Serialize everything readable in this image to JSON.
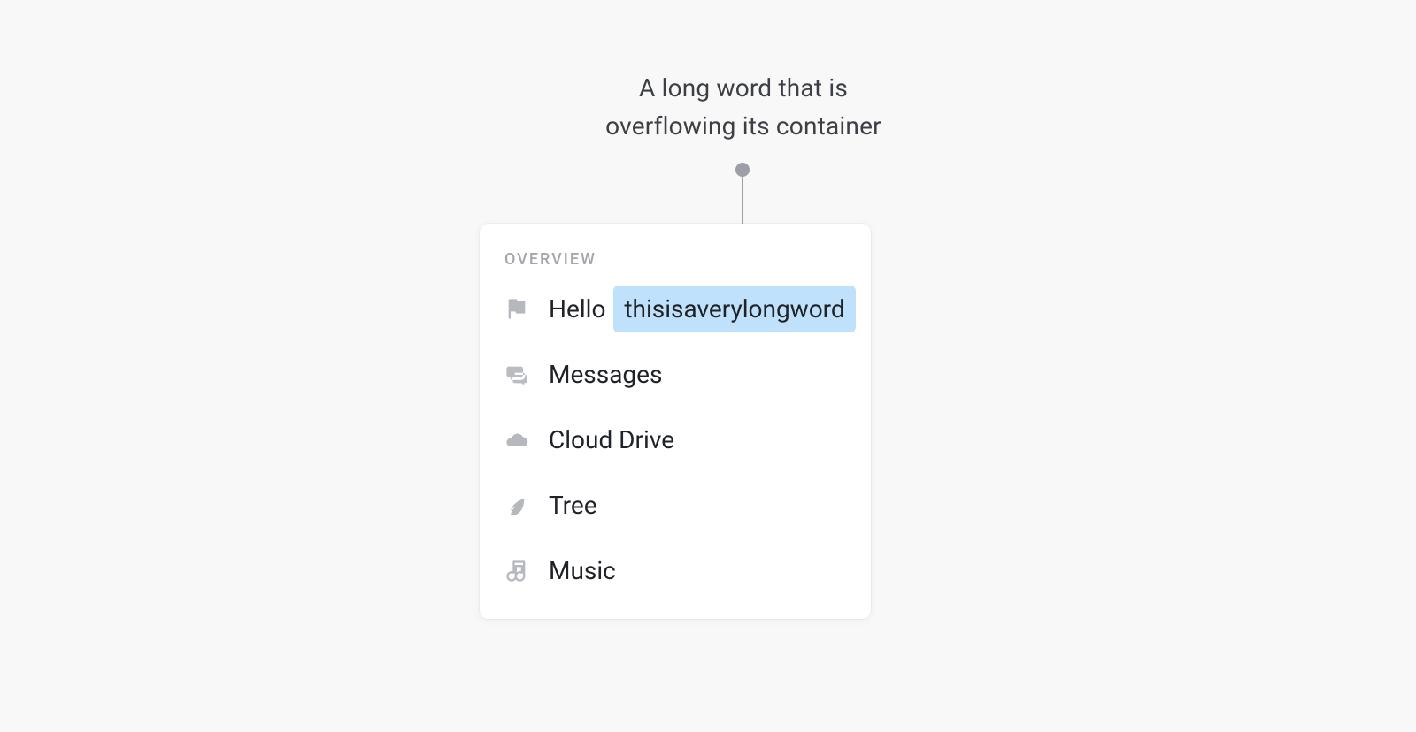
{
  "annotation": {
    "line1": "A long word that is",
    "line2": "overflowing its container"
  },
  "panel": {
    "section_label": "OVERVIEW",
    "items": [
      {
        "label_prefix": "Hello ",
        "highlighted": "thisisaverylongword",
        "full_label": "Hello thisisaverylongword"
      },
      {
        "label": "Messages"
      },
      {
        "label": "Cloud Drive"
      },
      {
        "label": "Tree"
      },
      {
        "label": "Music"
      }
    ]
  }
}
